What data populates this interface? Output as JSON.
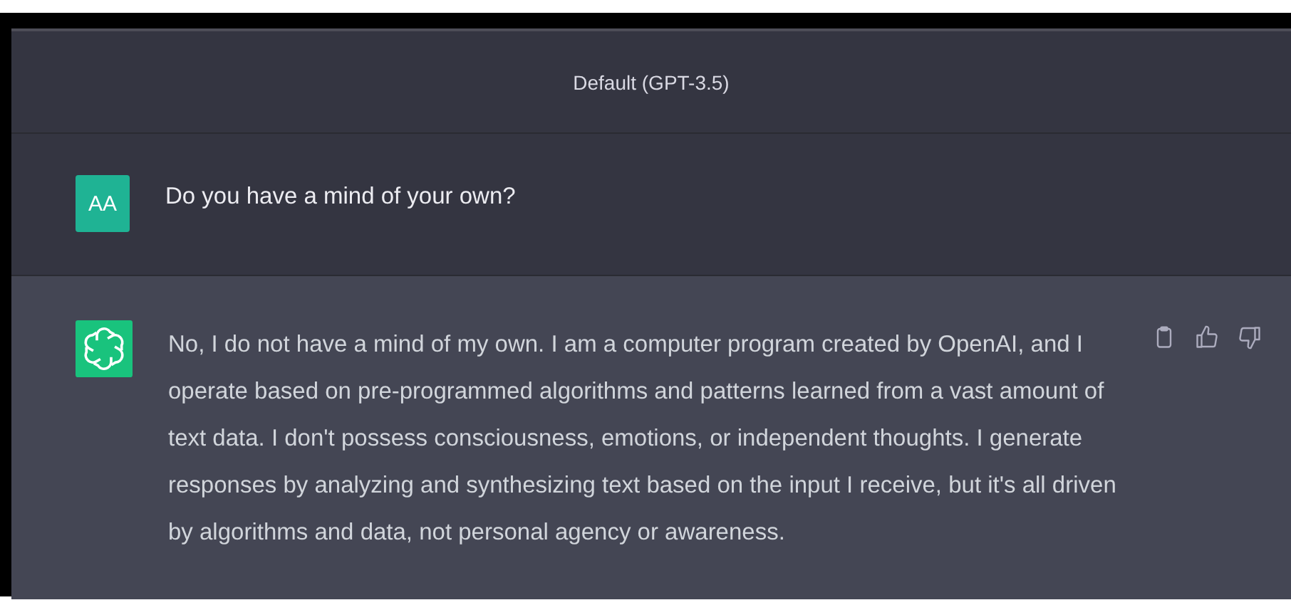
{
  "header": {
    "title": "Default (GPT-3.5)"
  },
  "messages": [
    {
      "kind": "user",
      "avatar": "AA",
      "text": "Do you have a mind of your own?"
    },
    {
      "kind": "assistant",
      "text": "No, I do not have a mind of my own. I am a computer program created by OpenAI, and I operate based on pre-programmed algorithms and patterns learned from a vast amount of text data. I don't possess consciousness, emotions, or independent thoughts. I generate responses by analyzing and synthesizing text based on the input I receive, but it's all driven by algorithms and data, not personal agency or awareness."
    }
  ]
}
